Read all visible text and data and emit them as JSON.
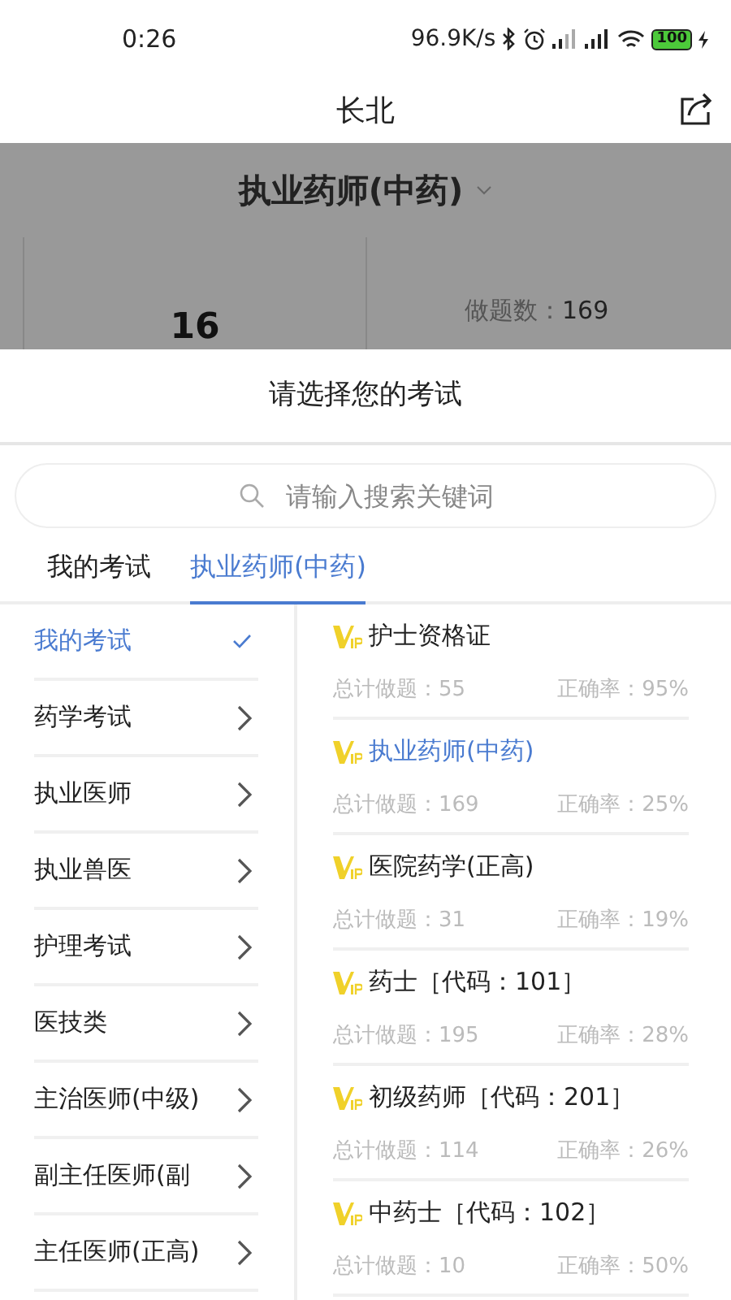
{
  "status_bar": {
    "time": "0:26",
    "speed": "96.9K/s",
    "battery": "100"
  },
  "header": {
    "title": "长北"
  },
  "background": {
    "exam_title": "执业药师(中药)",
    "big_number": "16",
    "count_label": "做题数：",
    "count_value": "169"
  },
  "sheet": {
    "title": "请选择您的考试",
    "search": {
      "placeholder": "请输入搜索关键词"
    },
    "tabs": [
      {
        "label": "我的考试",
        "selected": false
      },
      {
        "label": "执业药师(中药)",
        "selected": true
      }
    ],
    "categories": [
      {
        "label": "我的考试",
        "selected": true
      },
      {
        "label": "药学考试",
        "selected": false
      },
      {
        "label": "执业医师",
        "selected": false
      },
      {
        "label": "执业兽医",
        "selected": false
      },
      {
        "label": "护理考试",
        "selected": false
      },
      {
        "label": "医技类",
        "selected": false
      },
      {
        "label": "主治医师(中级)",
        "selected": false
      },
      {
        "label": "副主任医师(副",
        "selected": false
      },
      {
        "label": "主任医师(正高)",
        "selected": false
      }
    ],
    "exams": [
      {
        "name": "护士资格证",
        "selected": false,
        "total_label": "总计做题：",
        "total": "55",
        "rate_label": "正确率：",
        "rate": "95%"
      },
      {
        "name": "执业药师(中药)",
        "selected": true,
        "total_label": "总计做题：",
        "total": "169",
        "rate_label": "正确率：",
        "rate": "25%"
      },
      {
        "name": "医院药学(正高)",
        "selected": false,
        "total_label": "总计做题：",
        "total": "31",
        "rate_label": "正确率：",
        "rate": "19%"
      },
      {
        "name": "药士［代码：101］",
        "selected": false,
        "total_label": "总计做题：",
        "total": "195",
        "rate_label": "正确率：",
        "rate": "28%"
      },
      {
        "name": "初级药师［代码：201］",
        "selected": false,
        "total_label": "总计做题：",
        "total": "114",
        "rate_label": "正确率：",
        "rate": "26%"
      },
      {
        "name": "中药士［代码：102］",
        "selected": false,
        "total_label": "总计做题：",
        "total": "10",
        "rate_label": "正确率：",
        "rate": "50%"
      }
    ]
  }
}
